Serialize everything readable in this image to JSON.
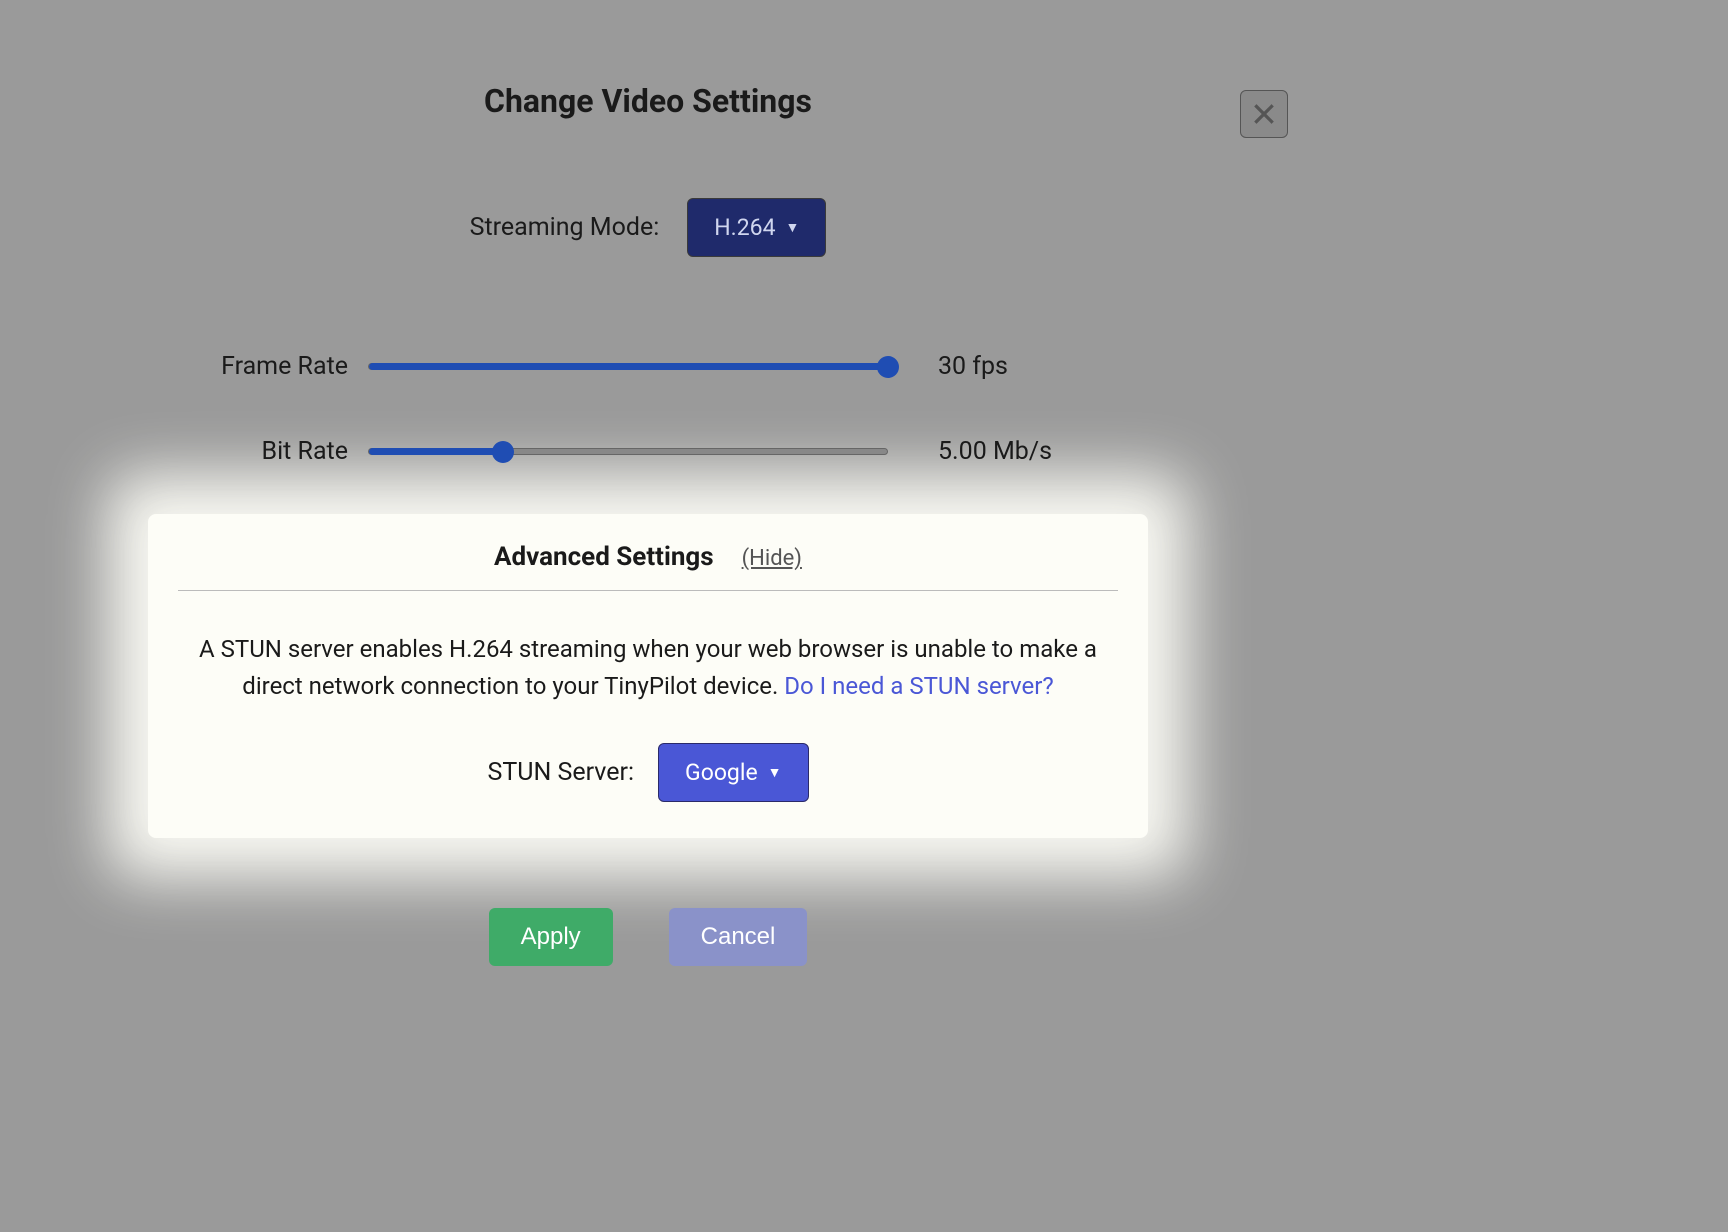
{
  "dialog": {
    "title": "Change Video Settings",
    "streaming_mode_label": "Streaming Mode:",
    "streaming_mode_value": "H.264",
    "frame_rate_label": "Frame Rate",
    "frame_rate_value": "30 fps",
    "frame_rate_fill_percent": 100,
    "bit_rate_label": "Bit Rate",
    "bit_rate_value": "5.00 Mb/s",
    "bit_rate_fill_percent": 26,
    "apply_label": "Apply",
    "cancel_label": "Cancel"
  },
  "advanced": {
    "title": "Advanced Settings",
    "hide_label": "(Hide)",
    "description_prefix": "A STUN server enables H.264 streaming when your web browser is unable to make a direct network connection to your TinyPilot device. ",
    "help_link_text": "Do I need a STUN server?",
    "stun_label": "STUN Server:",
    "stun_value": "Google"
  }
}
